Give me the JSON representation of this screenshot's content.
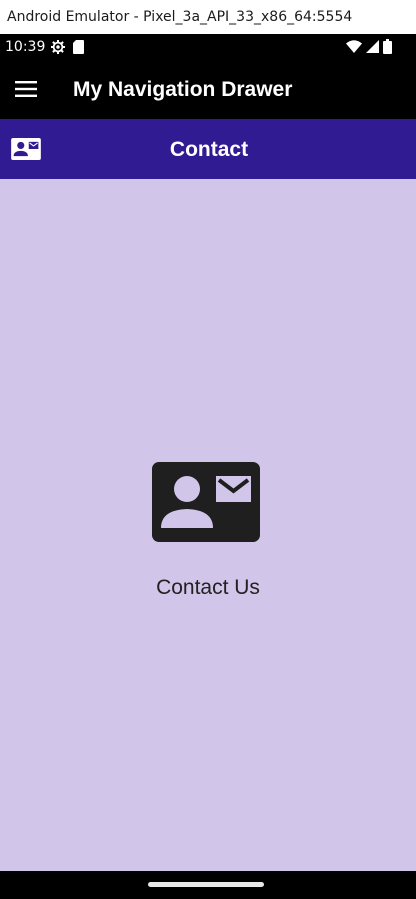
{
  "window": {
    "title": "Android Emulator - Pixel_3a_API_33_x86_64:5554"
  },
  "status_bar": {
    "time": "10:39",
    "left_icons": [
      "settings-icon",
      "sd-card-icon"
    ],
    "right_icons": [
      "wifi-icon",
      "signal-icon",
      "battery-icon"
    ]
  },
  "app_bar": {
    "title": "My Navigation Drawer",
    "menu_icon": "hamburger-menu-icon"
  },
  "section_header": {
    "title": "Contact",
    "icon": "contact-card-icon",
    "background": "#311b92"
  },
  "content": {
    "label": "Contact Us",
    "icon": "contact-card-icon",
    "background": "#d1c5e9"
  }
}
